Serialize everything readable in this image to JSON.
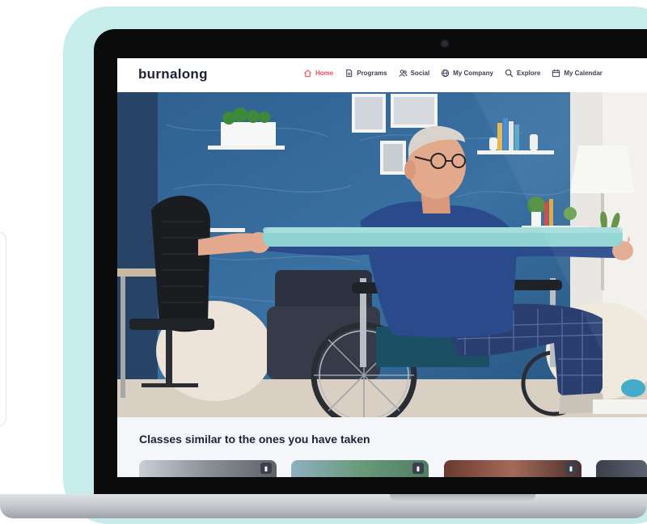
{
  "app": {
    "logo": "burnalong"
  },
  "nav": {
    "items": [
      {
        "label": "Home",
        "icon": "home-icon",
        "active": true
      },
      {
        "label": "Programs",
        "icon": "document-icon",
        "active": false
      },
      {
        "label": "Social",
        "icon": "people-icon",
        "active": false
      },
      {
        "label": "My Company",
        "icon": "globe-icon",
        "active": false
      },
      {
        "label": "Explore",
        "icon": "search-icon",
        "active": false
      },
      {
        "label": "My Calendar",
        "icon": "calendar-icon",
        "active": false
      }
    ]
  },
  "section": {
    "title": "Classes similar to the ones you have taken"
  },
  "colors": {
    "accent": "#ef4b58",
    "teal_card": "#c6ecec",
    "text_dark": "#1e2238",
    "band": "#8fd3d1"
  },
  "hero": {
    "image": "man-in-wheelchair-exercising-with-resistance-band"
  }
}
